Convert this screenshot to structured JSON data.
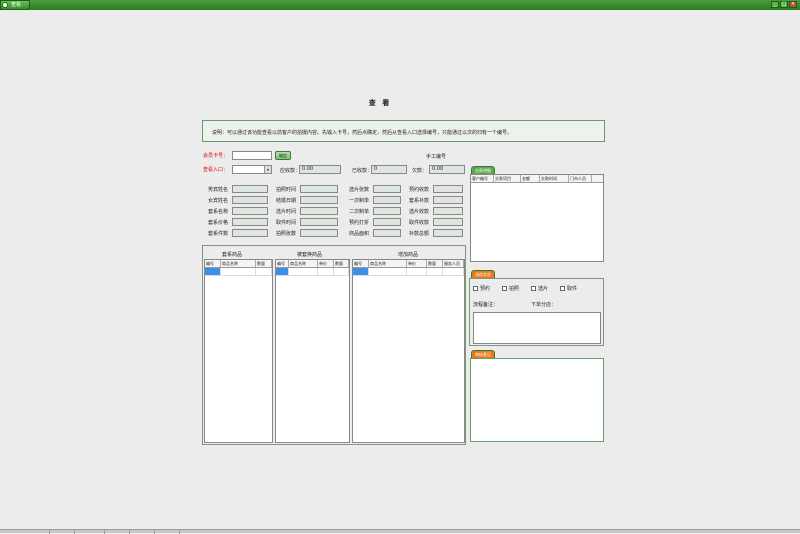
{
  "window": {
    "title": "查看",
    "min": "_",
    "max": "□",
    "close": "×"
  },
  "page_title": "查 看",
  "description": "说明：可以通过该功能查看以前客户的拍摄内容。先输入卡号，然后点确定，然后从查看入口选择编号，只能通过以次的归有一个编号。",
  "member": {
    "card_label": "会员卡号：",
    "card_value": "",
    "confirm": "确定",
    "entry_label": "查看入口：",
    "entry_value": "",
    "manual_no": "手工编号"
  },
  "totals": {
    "receivable_label": "应收款：",
    "receivable": "0.00",
    "received_label": "已收款：",
    "received": "0",
    "owed_label": "欠款：",
    "owed": "0.00"
  },
  "info_col1": [
    "男宾姓名",
    "女宾姓名",
    "套系名称",
    "套系价格",
    "套系件数"
  ],
  "info_col2": [
    "拍照时间",
    "结婚日期",
    "选片时间",
    "取件时间",
    "拍照张数"
  ],
  "info_col3": [
    "选片张数",
    "一次制单",
    "二次制单",
    "预约打折",
    "商品面积"
  ],
  "info_col4": [
    "预约收款",
    "套系补款",
    "选片收款",
    "取件收款",
    "补款总额"
  ],
  "tables": {
    "package": {
      "title": "套系商品",
      "cols": [
        "编号",
        "商品名称",
        "数量"
      ]
    },
    "extra": {
      "title": "被套换商品",
      "cols": [
        "编号",
        "商品名称",
        "单价",
        "数量"
      ]
    },
    "added": {
      "title": "增加商品",
      "cols": [
        "编号",
        "商品名称",
        "单价",
        "数量",
        "服务人员"
      ]
    }
  },
  "payments": {
    "tab": "交款明细",
    "cols": [
      "客户编号",
      "交款项目",
      "金额",
      "交款时间",
      "门市人员"
    ]
  },
  "process": {
    "tab": "流程状态",
    "checks": [
      "预约",
      "拍照",
      "选片",
      "取件"
    ],
    "note_label": "流程备注：",
    "branch_label": "下单分店："
  },
  "review": {
    "tab": "审核意见"
  }
}
